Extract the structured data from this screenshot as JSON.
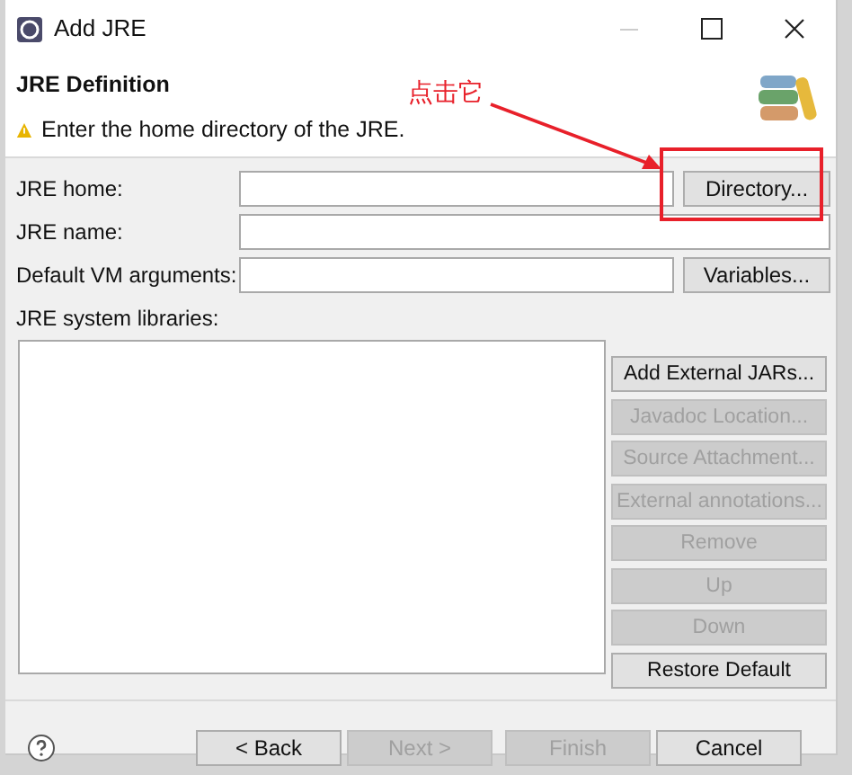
{
  "window": {
    "title": "Add JRE"
  },
  "header": {
    "title": "JRE Definition",
    "message": "Enter the home directory of the JRE."
  },
  "annotation": {
    "text": "点击它"
  },
  "fields": [
    {
      "label": "JRE home:",
      "button": {
        "label": "Directory...",
        "disabled": false
      }
    },
    {
      "label": "JRE name:"
    },
    {
      "label": "Default VM arguments:",
      "button": {
        "label": "Variables...",
        "disabled": false
      }
    }
  ],
  "libraries": {
    "label": "JRE system libraries:",
    "buttons": [
      {
        "label": "Add External JARs...",
        "disabled": false
      },
      {
        "label": "Javadoc Location...",
        "disabled": true
      },
      {
        "label": "Source Attachment...",
        "disabled": true
      },
      {
        "label": "External annotations...",
        "disabled": true
      },
      {
        "label": "Remove",
        "disabled": true
      },
      {
        "label": "Up",
        "disabled": true
      },
      {
        "label": "Down",
        "disabled": true
      },
      {
        "label": "Restore Default",
        "disabled": false
      }
    ]
  },
  "footer_buttons": [
    {
      "label": "< Back",
      "disabled": false
    },
    {
      "label": "Next >",
      "disabled": true
    },
    {
      "label": "Finish",
      "disabled": true
    },
    {
      "label": "Cancel",
      "disabled": false
    }
  ]
}
